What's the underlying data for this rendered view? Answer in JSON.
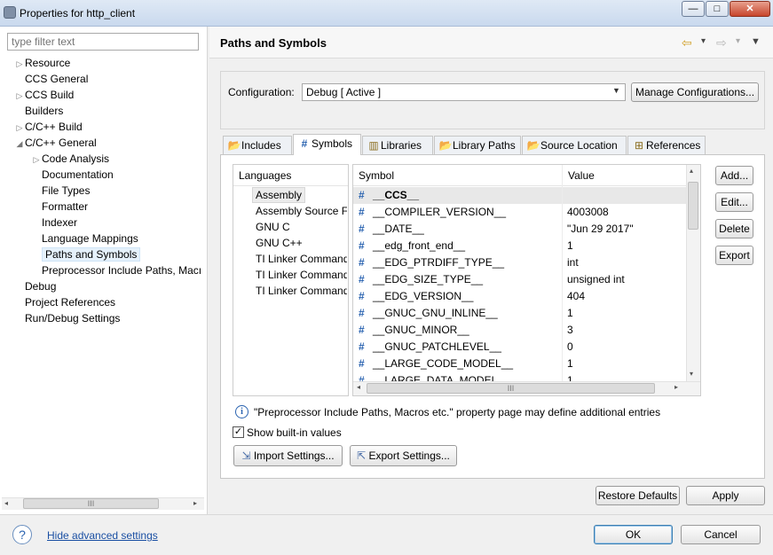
{
  "window": {
    "title": "Properties for http_client",
    "min_glyph": "—",
    "max_glyph": "□",
    "close_glyph": "✕"
  },
  "left": {
    "filter_placeholder": "type filter text",
    "tree": [
      {
        "label": "Resource",
        "indent": 0,
        "arrow": "▷"
      },
      {
        "label": "CCS General",
        "indent": 0,
        "arrow": ""
      },
      {
        "label": "CCS Build",
        "indent": 0,
        "arrow": "▷"
      },
      {
        "label": "Builders",
        "indent": 0,
        "arrow": ""
      },
      {
        "label": "C/C++ Build",
        "indent": 0,
        "arrow": "▷"
      },
      {
        "label": "C/C++ General",
        "indent": 0,
        "arrow": "◢"
      },
      {
        "label": "Code Analysis",
        "indent": 1,
        "arrow": "▷"
      },
      {
        "label": "Documentation",
        "indent": 1,
        "arrow": ""
      },
      {
        "label": "File Types",
        "indent": 1,
        "arrow": ""
      },
      {
        "label": "Formatter",
        "indent": 1,
        "arrow": ""
      },
      {
        "label": "Indexer",
        "indent": 1,
        "arrow": ""
      },
      {
        "label": "Language Mappings",
        "indent": 1,
        "arrow": ""
      },
      {
        "label": "Paths and Symbols",
        "indent": 1,
        "arrow": "",
        "selected": true
      },
      {
        "label": "Preprocessor Include Paths, Macı",
        "indent": 1,
        "arrow": ""
      },
      {
        "label": "Debug",
        "indent": 0,
        "arrow": ""
      },
      {
        "label": "Project References",
        "indent": 0,
        "arrow": ""
      },
      {
        "label": "Run/Debug Settings",
        "indent": 0,
        "arrow": ""
      }
    ],
    "scroll_grip": "III"
  },
  "header": {
    "title": "Paths and Symbols",
    "back_glyph": "⇦",
    "forward_glyph": "⇨",
    "drop_glyph": "▾",
    "menu_glyph": "▼"
  },
  "config": {
    "label": "Configuration:",
    "selected": "Debug  [ Active ]",
    "manage_label": "Manage Configurations..."
  },
  "tabs": [
    {
      "label": "Includes",
      "icon": "📂"
    },
    {
      "label": "Symbols",
      "icon": "#",
      "active": true
    },
    {
      "label": "Libraries",
      "icon": "▥"
    },
    {
      "label": "Library Paths",
      "icon": "📂"
    },
    {
      "label": "Source Location",
      "icon": "📂"
    },
    {
      "label": "References",
      "icon": "⊞"
    }
  ],
  "languages": {
    "header": "Languages",
    "items": [
      "Assembly",
      "Assembly Source Fi",
      "GNU C",
      "GNU C++",
      "TI Linker Command",
      "TI Linker Command",
      "TI Linker Command"
    ]
  },
  "symbols": {
    "col_symbol": "Symbol",
    "col_value": "Value",
    "hash": "#",
    "rows": [
      {
        "symbol": "__CCS__",
        "value": ""
      },
      {
        "symbol": "__COMPILER_VERSION__",
        "value": "4003008"
      },
      {
        "symbol": "__DATE__",
        "value": "\"Jun 29 2017\""
      },
      {
        "symbol": "__edg_front_end__",
        "value": "1"
      },
      {
        "symbol": "__EDG_PTRDIFF_TYPE__",
        "value": "int"
      },
      {
        "symbol": "__EDG_SIZE_TYPE__",
        "value": "unsigned int"
      },
      {
        "symbol": "__EDG_VERSION__",
        "value": "404"
      },
      {
        "symbol": "__GNUC_GNU_INLINE__",
        "value": "1"
      },
      {
        "symbol": "__GNUC_MINOR__",
        "value": "3"
      },
      {
        "symbol": "__GNUC_PATCHLEVEL__",
        "value": "0"
      },
      {
        "symbol": "__LARGE_CODE_MODEL__",
        "value": "1"
      },
      {
        "symbol": "__LARGE_DATA_MODEL__",
        "value": "1"
      }
    ],
    "scroll_grip": "III",
    "arrow_left": "◂",
    "arrow_right": "▸",
    "arrow_up": "▴",
    "arrow_down": "▾"
  },
  "actions": {
    "add": "Add...",
    "edit": "Edit...",
    "delete": "Delete",
    "export": "Export"
  },
  "info": {
    "glyph": "i",
    "text": "\"Preprocessor Include Paths, Macros etc.\" property page may define additional entries"
  },
  "show_builtin": {
    "label": "Show built-in values",
    "checked": true,
    "check_glyph": "✓"
  },
  "import_label": "Import Settings...",
  "export_settings_label": "Export Settings...",
  "restore_defaults": "Restore Defaults",
  "apply": "Apply",
  "help_glyph": "?",
  "hide_advanced": "Hide advanced settings",
  "ok": "OK",
  "cancel": "Cancel"
}
